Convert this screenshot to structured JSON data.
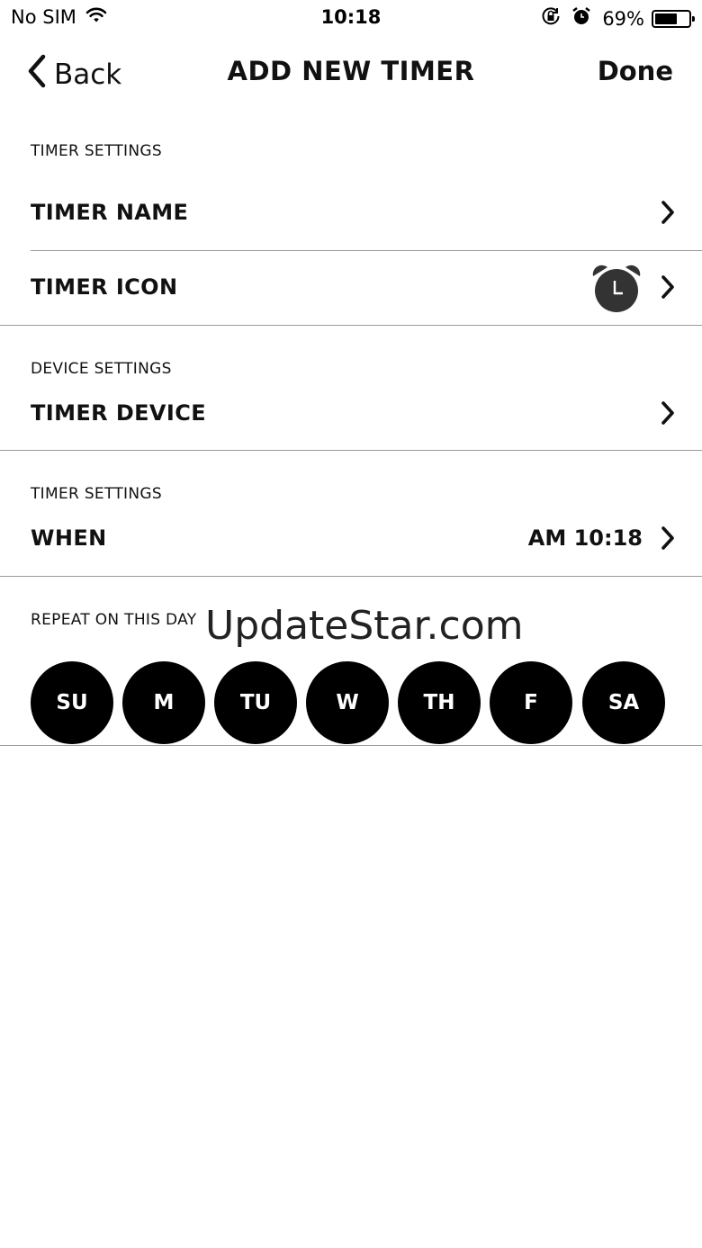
{
  "status_bar": {
    "carrier": "No SIM",
    "time": "10:18",
    "battery": "69%",
    "battery_level": 0.69
  },
  "nav": {
    "back_label": "Back",
    "title": "ADD NEW TIMER",
    "done_label": "Done"
  },
  "sections": {
    "timer_settings_header": "TIMER SETTINGS",
    "timer_name_label": "TIMER NAME",
    "timer_icon_label": "TIMER ICON",
    "device_settings_header": "DEVICE SETTINGS",
    "timer_device_label": "TIMER DEVICE",
    "timer_settings_header_2": "TIMER SETTINGS",
    "when_label": "WHEN",
    "when_value": "AM 10:18",
    "repeat_header": "REPEAT ON THIS DAY"
  },
  "watermark": "UpdateStar.com",
  "days": [
    "SU",
    "M",
    "TU",
    "W",
    "TH",
    "F",
    "SA"
  ],
  "colors": {
    "day_bg": "#000000",
    "day_text": "#ffffff",
    "divider": "#9a9a9a"
  }
}
